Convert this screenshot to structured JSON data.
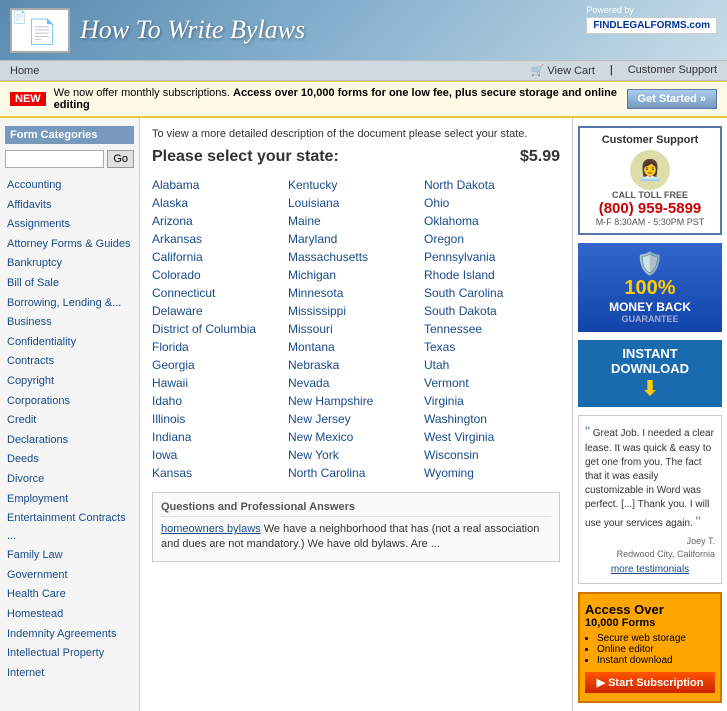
{
  "header": {
    "title": "How To Write Bylaws",
    "powered_by": "Powered by",
    "findlegalforms": "FINDLEGALFORMS.com"
  },
  "navbar": {
    "home": "Home",
    "view_cart": "View Cart",
    "customer_support": "Customer Support"
  },
  "subscription_bar": {
    "new_label": "NEW",
    "text": "We now offer monthly subscriptions.",
    "highlight": "Access over 10,000 forms for one low fee, plus secure storage and online editing",
    "btn_label": "Get Started »"
  },
  "sidebar": {
    "title": "Form Categories",
    "search_placeholder": "",
    "go_btn": "Go",
    "links": [
      "Accounting",
      "Affidavits",
      "Assignments",
      "Attorney Forms & Guides",
      "Bankruptcy",
      "Bill of Sale",
      "Borrowing, Lending &...",
      "Business",
      "Confidentiality",
      "Contracts",
      "Copyright",
      "Corporations",
      "Credit",
      "Declarations",
      "Deeds",
      "Divorce",
      "Employment",
      "Entertainment Contracts ...",
      "Family Law",
      "Government",
      "Health Care",
      "Homestead",
      "Indemnity Agreements",
      "Intellectual Property",
      "Internet"
    ]
  },
  "content": {
    "description": "To view a more detailed description of the document please select your state.",
    "heading": "Please select your state:",
    "price": "$5.99",
    "states_col1": [
      "Alabama",
      "Alaska",
      "Arizona",
      "Arkansas",
      "California",
      "Colorado",
      "Connecticut",
      "Delaware",
      "District of Columbia",
      "Florida",
      "Georgia",
      "Hawaii",
      "Idaho",
      "Illinois",
      "Indiana",
      "Iowa",
      "Kansas"
    ],
    "states_col2": [
      "Kentucky",
      "Louisiana",
      "Maine",
      "Maryland",
      "Massachusetts",
      "Michigan",
      "Minnesota",
      "Mississippi",
      "Missouri",
      "Montana",
      "Nebraska",
      "Nevada",
      "New Hampshire",
      "New Jersey",
      "New Mexico",
      "New York",
      "North Carolina"
    ],
    "states_col3": [
      "North Dakota",
      "Ohio",
      "Oklahoma",
      "Oregon",
      "Pennsylvania",
      "Rhode Island",
      "South Carolina",
      "South Dakota",
      "Tennessee",
      "Texas",
      "Utah",
      "Vermont",
      "Virginia",
      "Washington",
      "West Virginia",
      "Wisconsin",
      "Wyoming"
    ]
  },
  "qa": {
    "title": "Questions and Professional Answers",
    "link_text": "homeowners bylaws",
    "text": " We have a neighborhood that has (not a real association and dues are not mandatory.) We have old bylaws. Are ..."
  },
  "right_sidebar": {
    "customer_support": {
      "title": "Customer Support",
      "call_label": "CALL TOLL FREE",
      "phone": "(800) 959-5899",
      "hours": "M-F 8:30AM - 5:30PM PST"
    },
    "money_back": {
      "pct": "100%",
      "label": "MONEY BACK",
      "sub": "GUARANTEE"
    },
    "instant_download": "INSTANT DOWNLOAD",
    "testimonial": {
      "quote": "Great Job. I needed a clear lease. It was quick & easy to get one from you. The fact that it was easily customizable in Word was perfect. [...] Thank you. I will use your services again.",
      "author": "Joey T.",
      "location": "Redwood City, California"
    },
    "more_testimonials": "more testimonials",
    "access": {
      "title": "Access Over",
      "amount": "10,000 Forms",
      "features": [
        "Secure web storage",
        "Online editor",
        "Instant download"
      ],
      "btn_label": "▶ Start Subscription"
    }
  }
}
